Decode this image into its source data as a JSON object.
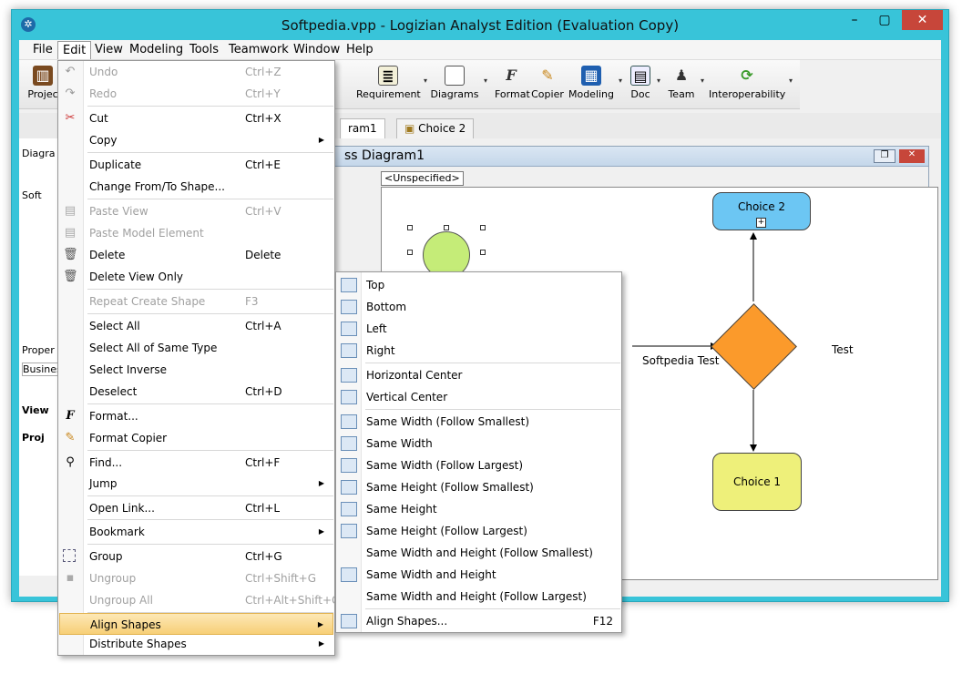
{
  "window": {
    "title": "Softpedia.vpp - Logizian Analyst Edition (Evaluation Copy)"
  },
  "menubar": [
    "File",
    "Edit",
    "View",
    "Modeling",
    "Tools",
    "Teamwork",
    "Window",
    "Help"
  ],
  "toolbar": {
    "project": "Projec",
    "requirement": "Requirement",
    "diagrams": "Diagrams",
    "format": "Format",
    "copier": "Copier",
    "modeling": "Modeling",
    "doc": "Doc",
    "team": "Team",
    "interoperability": "Interoperability"
  },
  "tabs": {
    "tab1": "ram1",
    "tab2": "Choice 2"
  },
  "left_pane": {
    "diagram": "Diagra",
    "soft": "Soft",
    "proper": "Proper",
    "business": "Business",
    "view": "View",
    "proj": "Proj"
  },
  "diagram": {
    "title": "ss Diagram1",
    "scope": "<Unspecified>",
    "choice2": "Choice 2",
    "choice1": "Choice 1",
    "flow_label": "Softpedia Test",
    "test_label": "Test"
  },
  "edit_menu": [
    {
      "label": "Undo",
      "key": "Ctrl+Z",
      "disabled": true
    },
    {
      "label": "Redo",
      "key": "Ctrl+Y",
      "disabled": true
    },
    {
      "label": "Cut",
      "key": "Ctrl+X"
    },
    {
      "label": "Copy",
      "key": ""
    },
    {
      "label": "Duplicate",
      "key": "Ctrl+E"
    },
    {
      "label": "Change From/To Shape...",
      "key": ""
    },
    {
      "label": "Paste View",
      "key": "Ctrl+V",
      "disabled": true
    },
    {
      "label": "Paste Model Element",
      "key": "",
      "disabled": true
    },
    {
      "label": "Delete",
      "key": "Delete"
    },
    {
      "label": "Delete View Only",
      "key": ""
    },
    {
      "label": "Repeat Create Shape",
      "key": "F3",
      "disabled": true
    },
    {
      "label": "Select All",
      "key": "Ctrl+A"
    },
    {
      "label": "Select All of Same Type",
      "key": ""
    },
    {
      "label": "Select Inverse",
      "key": ""
    },
    {
      "label": "Deselect",
      "key": "Ctrl+D"
    },
    {
      "label": "Format...",
      "key": ""
    },
    {
      "label": "Format Copier",
      "key": ""
    },
    {
      "label": "Find...",
      "key": "Ctrl+F"
    },
    {
      "label": "Jump",
      "key": ""
    },
    {
      "label": "Open Link...",
      "key": "Ctrl+L"
    },
    {
      "label": "Bookmark",
      "key": ""
    },
    {
      "label": "Group",
      "key": "Ctrl+G"
    },
    {
      "label": "Ungroup",
      "key": "Ctrl+Shift+G",
      "disabled": true
    },
    {
      "label": "Ungroup All",
      "key": "Ctrl+Alt+Shift+G",
      "disabled": true
    },
    {
      "label": "Align Shapes",
      "key": ""
    },
    {
      "label": "Distribute Shapes",
      "key": ""
    }
  ],
  "align_menu": [
    {
      "label": "Top",
      "key": ""
    },
    {
      "label": "Bottom",
      "key": ""
    },
    {
      "label": "Left",
      "key": ""
    },
    {
      "label": "Right",
      "key": ""
    },
    {
      "label": "Horizontal Center",
      "key": ""
    },
    {
      "label": "Vertical Center",
      "key": ""
    },
    {
      "label": "Same Width (Follow Smallest)",
      "key": ""
    },
    {
      "label": "Same Width",
      "key": ""
    },
    {
      "label": "Same Width (Follow Largest)",
      "key": ""
    },
    {
      "label": "Same Height (Follow Smallest)",
      "key": ""
    },
    {
      "label": "Same Height",
      "key": ""
    },
    {
      "label": "Same Height (Follow Largest)",
      "key": ""
    },
    {
      "label": "Same Width and Height (Follow Smallest)",
      "key": ""
    },
    {
      "label": "Same Width and Height",
      "key": ""
    },
    {
      "label": "Same Width and Height (Follow Largest)",
      "key": ""
    },
    {
      "label": "Align Shapes...",
      "key": "F12"
    }
  ],
  "colors": {
    "titlebar": "#38c4d9",
    "choice2": "#6cc6f3",
    "choice1": "#eef07a",
    "diamond": "#fb9a2b",
    "circle": "#c5ec78",
    "highlight": "#f7cf77"
  }
}
